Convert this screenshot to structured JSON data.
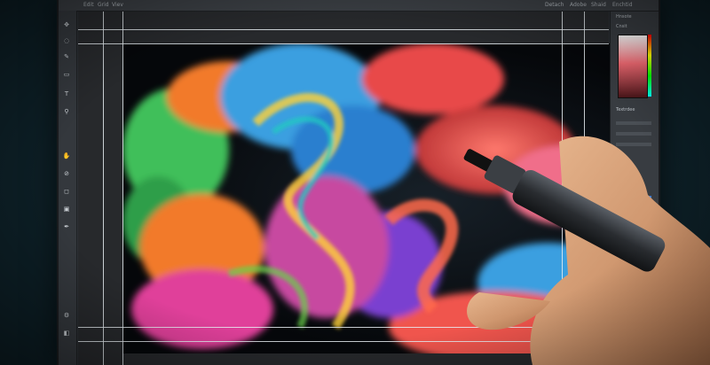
{
  "menubar": {
    "items": [
      "Edit",
      "Grid",
      "Viev",
      "Detach",
      "Adobe",
      "Shaid",
      "Enchtid"
    ]
  },
  "panel": {
    "header": "Hnsote",
    "sub_label": "Cnsit",
    "mid_label": "Textrdee"
  },
  "toolbar": {
    "icons": [
      "move-icon",
      "lasso-icon",
      "brush-icon",
      "eraser-icon",
      "text-icon",
      "zoom-icon",
      "hand-icon"
    ]
  },
  "colors": {
    "screen_bg": "#2e3237",
    "backdrop": "#0d1f26",
    "smoke_red": "#f0554d",
    "smoke_blue": "#3a9fe0",
    "smoke_green": "#3fbf5a",
    "smoke_magenta": "#e0409a",
    "smoke_orange": "#f27a2a"
  }
}
